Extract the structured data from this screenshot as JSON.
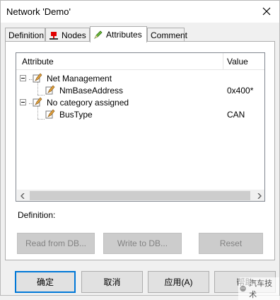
{
  "window": {
    "title": "Network 'Demo'"
  },
  "tabs": [
    {
      "label": "Definition",
      "active": false,
      "icon": null
    },
    {
      "label": "Nodes",
      "active": false,
      "icon": "red-node-icon"
    },
    {
      "label": "Attributes",
      "active": true,
      "icon": "pencil-attribute-icon"
    },
    {
      "label": "Comment",
      "active": false,
      "icon": null
    }
  ],
  "attributes_tree": {
    "columns": [
      "Attribute",
      "Value"
    ],
    "rows": [
      {
        "label": "Net Management",
        "value": "",
        "level": 0,
        "expanded": true
      },
      {
        "label": "NmBaseAddress",
        "value": "0x400*",
        "level": 1
      },
      {
        "label": "No category assigned",
        "value": "",
        "level": 0,
        "expanded": true
      },
      {
        "label": "BusType",
        "value": "CAN",
        "level": 1
      }
    ]
  },
  "definition_label": "Definition:",
  "db_buttons": {
    "read": "Read from DB...",
    "write": "Write to DB...",
    "reset": "Reset"
  },
  "footer_buttons": {
    "ok": "确定",
    "cancel": "取消",
    "apply": "应用(A)",
    "help": "帮助"
  },
  "watermark": "汽车技术",
  "colors": {
    "accent": "#0078d7",
    "node_icon": "#e00000",
    "attr_icon": "#f0c040"
  }
}
